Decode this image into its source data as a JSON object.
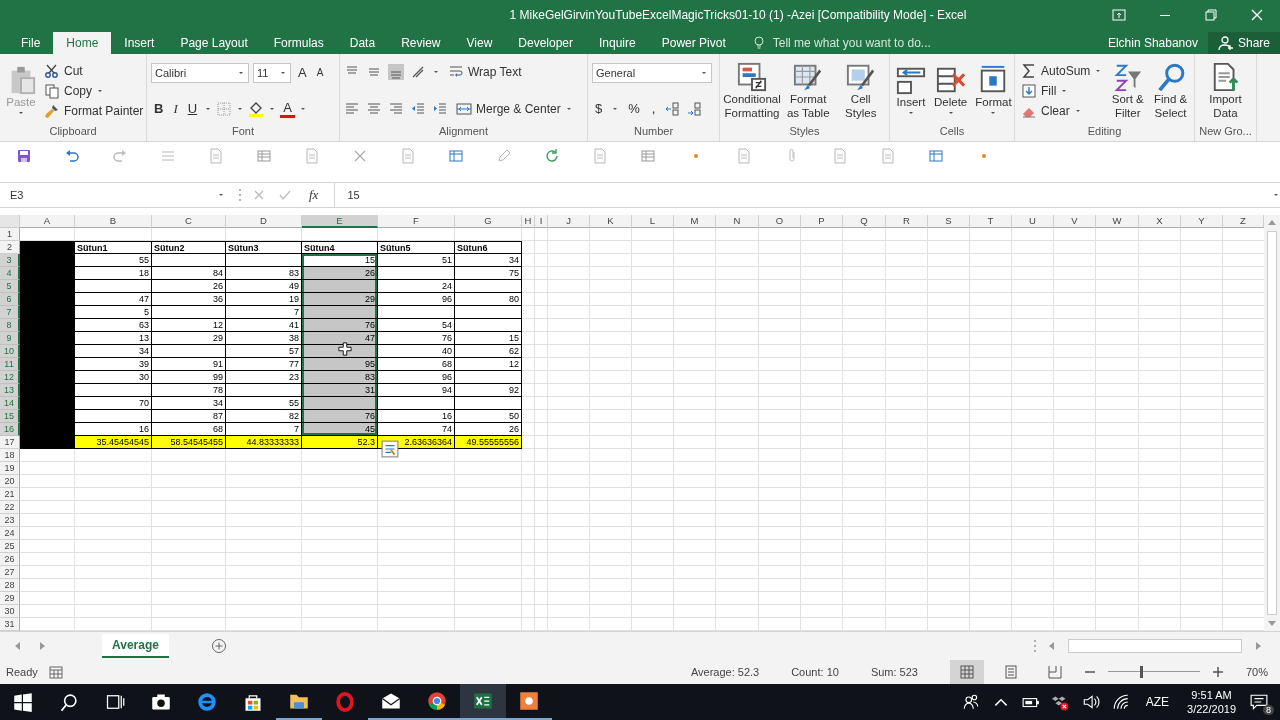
{
  "window": {
    "title": "1 MikeGelGirvinYouTubeExcelMagicTricks01-10 (1) -Azei  [Compatibility Mode] - Excel"
  },
  "tabs": [
    {
      "label": "File",
      "selected": false
    },
    {
      "label": "Home",
      "selected": true
    },
    {
      "label": "Insert",
      "selected": false
    },
    {
      "label": "Page Layout",
      "selected": false
    },
    {
      "label": "Formulas",
      "selected": false
    },
    {
      "label": "Data",
      "selected": false
    },
    {
      "label": "Review",
      "selected": false
    },
    {
      "label": "View",
      "selected": false
    },
    {
      "label": "Developer",
      "selected": false
    },
    {
      "label": "Inquire",
      "selected": false
    },
    {
      "label": "Power Pivot",
      "selected": false
    }
  ],
  "tell_me": {
    "placeholder": "Tell me what you want to do..."
  },
  "user": "Elchin Shabanov",
  "share": "Share",
  "ribbon": {
    "clipboard": {
      "label": "Clipboard",
      "paste": "Paste",
      "cut": "Cut",
      "copy": "Copy",
      "format_painter": "Format Painter"
    },
    "font": {
      "label": "Font",
      "family": "Calibri",
      "size": "11",
      "grow": "A",
      "shrink": "A",
      "bold": "B",
      "italic": "I",
      "underline": "U",
      "font_color": "A"
    },
    "alignment": {
      "label": "Alignment",
      "wrap_text": "Wrap Text",
      "merge_center": "Merge & Center"
    },
    "number": {
      "label": "Number",
      "format": "General",
      "currency": "$",
      "percent": "%",
      "comma": ","
    },
    "styles": {
      "label": "Styles",
      "buttons": [
        "Conditional Formatting",
        "Format as Table",
        "Cell Styles"
      ]
    },
    "cells": {
      "label": "Cells",
      "buttons": [
        "Insert",
        "Delete",
        "Format"
      ]
    },
    "editing": {
      "label": "Editing",
      "autosum": "AutoSum",
      "fill": "Fill",
      "clear": "Clear",
      "buttons": [
        "Sort & Filter",
        "Find & Select"
      ]
    },
    "new_group": {
      "label": "New Gro...",
      "buttons": [
        "Import Data"
      ]
    }
  },
  "formula_bar": {
    "name_box": "E3",
    "fx": "fx",
    "value": "15"
  },
  "sheet": {
    "columns": [
      {
        "label": "A",
        "selected": false
      },
      {
        "label": "B",
        "selected": false
      },
      {
        "label": "C",
        "selected": false
      },
      {
        "label": "D",
        "selected": false
      },
      {
        "label": "E",
        "selected": true
      },
      {
        "label": "F",
        "selected": false
      },
      {
        "label": "G",
        "selected": false
      },
      {
        "label": "H",
        "selected": false
      },
      {
        "label": "I",
        "selected": false
      },
      {
        "label": "J",
        "selected": false
      },
      {
        "label": "K",
        "selected": false
      },
      {
        "label": "L",
        "selected": false
      },
      {
        "label": "M",
        "selected": false
      },
      {
        "label": "N",
        "selected": false
      },
      {
        "label": "O",
        "selected": false
      },
      {
        "label": "P",
        "selected": false
      },
      {
        "label": "Q",
        "selected": false
      },
      {
        "label": "R",
        "selected": false
      },
      {
        "label": "S",
        "selected": false
      },
      {
        "label": "T",
        "selected": false
      },
      {
        "label": "U",
        "selected": false
      },
      {
        "label": "V",
        "selected": false
      },
      {
        "label": "W",
        "selected": false
      },
      {
        "label": "X",
        "selected": false
      },
      {
        "label": "Y",
        "selected": false
      },
      {
        "label": "Z",
        "selected": false
      }
    ],
    "rows": [
      {
        "label": "1",
        "selected": false
      },
      {
        "label": "2",
        "selected": false,
        "kind": "header",
        "cells": [
          {
            "value": "Sütun1",
            "selected": false
          },
          {
            "value": "Sütun2",
            "selected": false
          },
          {
            "value": "Sütun3",
            "selected": false
          },
          {
            "value": "Sütun4",
            "selected": false
          },
          {
            "value": "Sütun5",
            "selected": false
          },
          {
            "value": "Sütun6",
            "selected": false
          }
        ]
      },
      {
        "label": "3",
        "selected": true,
        "kind": "data",
        "cells": [
          {
            "value": "55",
            "selected": false
          },
          {
            "selected": false
          },
          {
            "selected": false
          },
          {
            "value": "15",
            "selected": true,
            "active": true
          },
          {
            "value": "51",
            "selected": false
          },
          {
            "value": "34",
            "selected": false
          }
        ]
      },
      {
        "label": "4",
        "selected": true,
        "kind": "data",
        "cells": [
          {
            "value": "18",
            "selected": false
          },
          {
            "value": "84",
            "selected": false
          },
          {
            "value": "83",
            "selected": false
          },
          {
            "value": "26",
            "selected": true
          },
          {
            "selected": false
          },
          {
            "value": "75",
            "selected": false
          }
        ]
      },
      {
        "label": "5",
        "selected": true,
        "kind": "data",
        "cells": [
          {
            "selected": false
          },
          {
            "value": "26",
            "selected": false
          },
          {
            "value": "49",
            "selected": false
          },
          {
            "selected": true
          },
          {
            "value": "24",
            "selected": false
          },
          {
            "selected": false
          }
        ]
      },
      {
        "label": "6",
        "selected": true,
        "kind": "data",
        "cells": [
          {
            "value": "47",
            "selected": false
          },
          {
            "value": "36",
            "selected": false
          },
          {
            "value": "19",
            "selected": false
          },
          {
            "value": "29",
            "selected": true
          },
          {
            "value": "96",
            "selected": false
          },
          {
            "value": "80",
            "selected": false
          }
        ]
      },
      {
        "label": "7",
        "selected": true,
        "kind": "data",
        "cells": [
          {
            "value": "5",
            "selected": false
          },
          {
            "selected": false
          },
          {
            "value": "7",
            "selected": false
          },
          {
            "selected": true
          },
          {
            "selected": false
          },
          {
            "selected": false
          }
        ]
      },
      {
        "label": "8",
        "selected": true,
        "kind": "data",
        "cells": [
          {
            "value": "63",
            "selected": false
          },
          {
            "value": "12",
            "selected": false
          },
          {
            "value": "41",
            "selected": false
          },
          {
            "value": "76",
            "selected": true
          },
          {
            "value": "54",
            "selected": false
          },
          {
            "selected": false
          }
        ]
      },
      {
        "label": "9",
        "selected": true,
        "kind": "data",
        "cells": [
          {
            "value": "13",
            "selected": false
          },
          {
            "value": "29",
            "selected": false
          },
          {
            "value": "38",
            "selected": false
          },
          {
            "value": "47",
            "selected": true
          },
          {
            "value": "76",
            "selected": false
          },
          {
            "value": "15",
            "selected": false
          }
        ]
      },
      {
        "label": "10",
        "selected": true,
        "kind": "data",
        "cells": [
          {
            "value": "34",
            "selected": false
          },
          {
            "selected": false
          },
          {
            "value": "57",
            "selected": false
          },
          {
            "selected": true
          },
          {
            "value": "40",
            "selected": false
          },
          {
            "value": "62",
            "selected": false
          }
        ]
      },
      {
        "label": "11",
        "selected": true,
        "kind": "data",
        "cells": [
          {
            "value": "39",
            "selected": false
          },
          {
            "value": "91",
            "selected": false
          },
          {
            "value": "77",
            "selected": false
          },
          {
            "value": "95",
            "selected": true
          },
          {
            "value": "68",
            "selected": false
          },
          {
            "value": "12",
            "selected": false
          }
        ]
      },
      {
        "label": "12",
        "selected": true,
        "kind": "data",
        "cells": [
          {
            "value": "30",
            "selected": false
          },
          {
            "value": "99",
            "selected": false
          },
          {
            "value": "23",
            "selected": false
          },
          {
            "value": "83",
            "selected": true
          },
          {
            "value": "96",
            "selected": false
          },
          {
            "selected": false
          }
        ]
      },
      {
        "label": "13",
        "selected": true,
        "kind": "data",
        "cells": [
          {
            "selected": false
          },
          {
            "value": "78",
            "selected": false
          },
          {
            "selected": false
          },
          {
            "value": "31",
            "selected": true
          },
          {
            "value": "94",
            "selected": false
          },
          {
            "value": "92",
            "selected": false
          }
        ]
      },
      {
        "label": "14",
        "selected": true,
        "kind": "data",
        "cells": [
          {
            "value": "70",
            "selected": false
          },
          {
            "value": "34",
            "selected": false
          },
          {
            "value": "55",
            "selected": false
          },
          {
            "selected": true
          },
          {
            "selected": false
          },
          {
            "selected": false
          }
        ]
      },
      {
        "label": "15",
        "selected": true,
        "kind": "data",
        "cells": [
          {
            "selected": false
          },
          {
            "value": "87",
            "selected": false
          },
          {
            "value": "82",
            "selected": false
          },
          {
            "value": "76",
            "selected": true
          },
          {
            "value": "16",
            "selected": false
          },
          {
            "value": "50",
            "selected": false
          }
        ]
      },
      {
        "label": "16",
        "selected": true,
        "kind": "data",
        "cells": [
          {
            "value": "16",
            "selected": false
          },
          {
            "value": "68",
            "selected": false
          },
          {
            "value": "7",
            "selected": false
          },
          {
            "value": "45",
            "selected": true
          },
          {
            "value": "74",
            "selected": false
          },
          {
            "value": "26",
            "selected": false
          }
        ]
      },
      {
        "label": "17",
        "selected": false,
        "kind": "total",
        "cells": [
          {
            "value": "35.45454545",
            "selected": false
          },
          {
            "value": "58.54545455",
            "selected": false
          },
          {
            "value": "44.83333333",
            "selected": false
          },
          {
            "value": "52.3",
            "selected": false
          },
          {
            "value": "2.63636364",
            "selected": false
          },
          {
            "value": "49.55555556",
            "selected": false
          }
        ]
      },
      {
        "label": "18",
        "selected": false
      },
      {
        "label": "19",
        "selected": false
      },
      {
        "label": "20",
        "selected": false
      },
      {
        "label": "21",
        "selected": false
      },
      {
        "label": "22",
        "selected": false
      },
      {
        "label": "23",
        "selected": false
      },
      {
        "label": "24",
        "selected": false
      },
      {
        "label": "25",
        "selected": false
      },
      {
        "label": "26",
        "selected": false
      },
      {
        "label": "27",
        "selected": false
      },
      {
        "label": "28",
        "selected": false
      },
      {
        "label": "29",
        "selected": false
      },
      {
        "label": "30",
        "selected": false
      },
      {
        "label": "31",
        "selected": false
      }
    ]
  },
  "sheet_tabs": [
    {
      "label": "Average",
      "selected": true
    }
  ],
  "status": {
    "mode": "Ready",
    "average": "Average: 52.3",
    "count": "Count: 10",
    "sum": "Sum: 523",
    "views": [
      {
        "kind": "normal",
        "selected": true
      },
      {
        "kind": "page_layout",
        "selected": false
      },
      {
        "kind": "page_break",
        "selected": false
      }
    ],
    "zoom": {
      "level": 0.35,
      "label": "70%"
    }
  },
  "taskbar": {
    "apps": [
      {
        "kind": "camera",
        "open": false,
        "selected": false
      },
      {
        "kind": "browser",
        "open": false,
        "selected": false
      },
      {
        "kind": "store",
        "open": false,
        "selected": false
      },
      {
        "kind": "folder",
        "open": true,
        "selected": false
      },
      {
        "kind": "ring",
        "open": false,
        "selected": false
      },
      {
        "kind": "mail",
        "open": true,
        "selected": false
      },
      {
        "kind": "ball",
        "open": true,
        "selected": false
      },
      {
        "kind": "spreadsheet",
        "open": true,
        "selected": true
      },
      {
        "kind": "recorder",
        "open": true,
        "selected": false
      }
    ],
    "language": "AZE",
    "time": "9:51 AM",
    "date": "3/22/2019",
    "notifications": "8"
  }
}
